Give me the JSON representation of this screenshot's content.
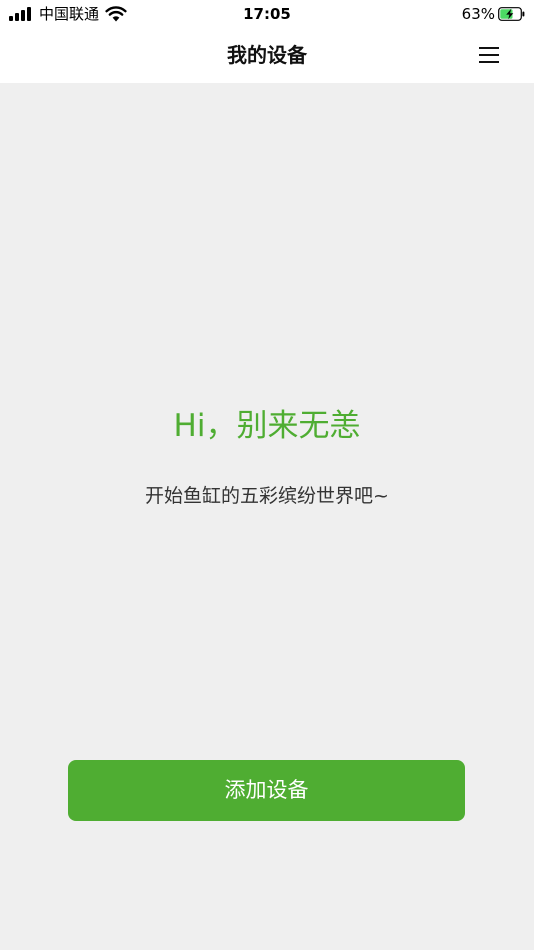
{
  "status_bar": {
    "carrier": "中国联通",
    "time": "17:05",
    "battery_percent": "63%",
    "battery_level": 0.63,
    "signal_icon": "signal-bars-icon",
    "wifi_icon": "wifi-icon",
    "battery_icon": "battery-charging-icon"
  },
  "nav": {
    "title": "我的设备",
    "menu_icon": "hamburger-menu-icon"
  },
  "content": {
    "greeting": "Hi，别来无恙",
    "subtitle": "开始鱼缸的五彩缤纷世界吧~"
  },
  "actions": {
    "add_device_label": "添加设备"
  },
  "colors": {
    "accent": "#4fad32",
    "background": "#efefef",
    "header_background": "#ffffff"
  }
}
